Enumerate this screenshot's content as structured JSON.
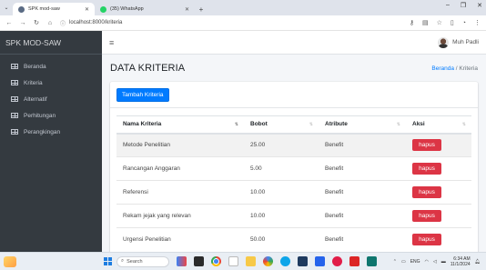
{
  "browser": {
    "tabs": [
      {
        "title": "SPK mod-saw",
        "active": true,
        "favicon_color": "#5a6b84"
      },
      {
        "title": "(35) WhatsApp",
        "active": false,
        "favicon_color": "#25d366"
      }
    ],
    "url": "localhost:8000/kriteria"
  },
  "sidebar": {
    "brand": "SPK MOD-SAW",
    "items": [
      {
        "label": "Beranda"
      },
      {
        "label": "Kriteria"
      },
      {
        "label": "Alternatif"
      },
      {
        "label": "Perhitungan"
      },
      {
        "label": "Perangkingan"
      }
    ]
  },
  "topnav": {
    "user_name": "Muh Padli"
  },
  "page": {
    "title": "DATA KRITERIA",
    "breadcrumb_home": "Beranda",
    "breadcrumb_sep": "/",
    "breadcrumb_current": "Kriteria"
  },
  "card": {
    "add_button": "Tambah Kriteria"
  },
  "table": {
    "headers": [
      "Nama Kriteria",
      "Bobot",
      "Atribute",
      "Aksi"
    ],
    "rows": [
      {
        "nama": "Metode Penelitian",
        "bobot": "25.00",
        "atribute": "Benefit",
        "aksi": "hapus"
      },
      {
        "nama": "Rancangan Anggaran",
        "bobot": "5.00",
        "atribute": "Benefit",
        "aksi": "hapus"
      },
      {
        "nama": "Referensi",
        "bobot": "10.00",
        "atribute": "Benefit",
        "aksi": "hapus"
      },
      {
        "nama": "Rekam jejak yang relevan",
        "bobot": "10.00",
        "atribute": "Benefit",
        "aksi": "hapus"
      },
      {
        "nama": "Urgensi Penelitian",
        "bobot": "50.00",
        "atribute": "Benefit",
        "aksi": "hapus"
      }
    ]
  },
  "taskbar": {
    "search_placeholder": "Search",
    "language": "ENG",
    "time": "6:34 AM",
    "date": "11/1/2024"
  },
  "colors": {
    "primary": "#007bff",
    "danger": "#dc3545",
    "sidebar_bg": "#343a40"
  }
}
